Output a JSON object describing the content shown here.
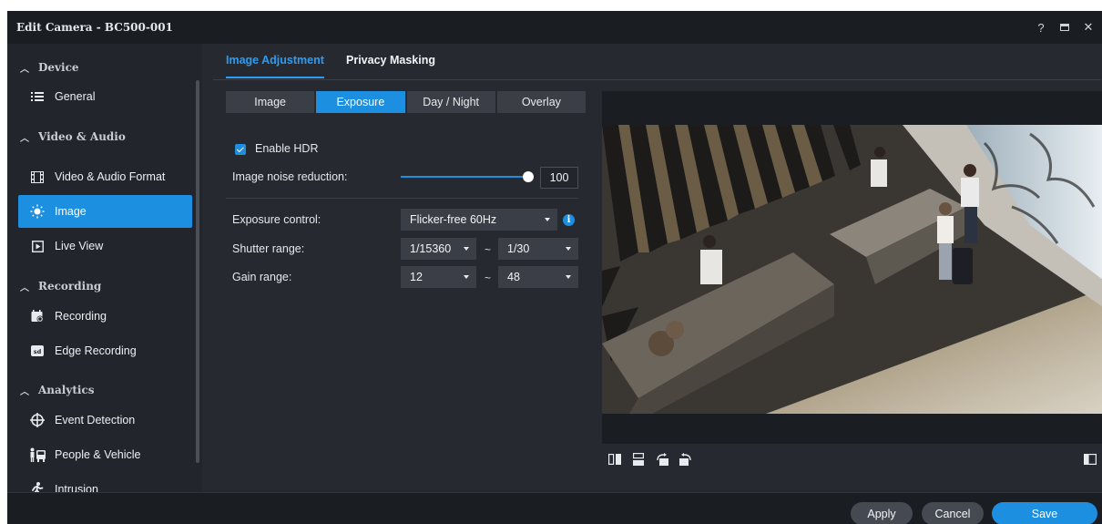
{
  "window": {
    "title": "Edit Camera - BC500-001"
  },
  "sidebar": {
    "sections": [
      {
        "label": "Device"
      },
      {
        "label": "Video & Audio"
      },
      {
        "label": "Recording"
      },
      {
        "label": "Analytics"
      }
    ],
    "items": [
      {
        "label": "General",
        "icon": "list-icon"
      },
      {
        "label": "Video & Audio Format",
        "icon": "film-icon"
      },
      {
        "label": "Image",
        "icon": "brightness-icon",
        "active": true
      },
      {
        "label": "Live View",
        "icon": "play-icon"
      },
      {
        "label": "Recording",
        "icon": "calendar-icon"
      },
      {
        "label": "Edge Recording",
        "icon": "sd-card-icon"
      },
      {
        "label": "Event Detection",
        "icon": "crosshair-icon"
      },
      {
        "label": "People & Vehicle",
        "icon": "person-vehicle-icon"
      },
      {
        "label": "Intrusion",
        "icon": "running-person-icon"
      }
    ]
  },
  "tabs": [
    {
      "label": "Image Adjustment",
      "active": true
    },
    {
      "label": "Privacy Masking",
      "active": false
    }
  ],
  "subtabs": [
    {
      "label": "Image",
      "active": false
    },
    {
      "label": "Exposure",
      "active": true
    },
    {
      "label": "Day / Night",
      "active": false
    },
    {
      "label": "Overlay",
      "active": false
    }
  ],
  "settings": {
    "enable_hdr": {
      "label": "Enable HDR",
      "checked": true
    },
    "noise_reduction": {
      "label": "Image noise reduction:",
      "value": "100",
      "level_percent": 100
    },
    "exposure_control": {
      "label": "Exposure control:",
      "value": "Flicker-free 60Hz"
    },
    "shutter_range": {
      "label": "Shutter range:",
      "min": "1/15360",
      "separator": "~",
      "max": "1/30"
    },
    "gain_range": {
      "label": "Gain range:",
      "min": "12",
      "separator": "~",
      "max": "48"
    }
  },
  "preview": {
    "tools": [
      "flip-horizontal-icon",
      "flip-vertical-icon",
      "rotate-left-icon",
      "rotate-right-icon"
    ],
    "right_tool": "panel-toggle-icon"
  },
  "footer": {
    "apply": "Apply",
    "cancel": "Cancel",
    "save": "Save"
  },
  "colors": {
    "accent": "#1c8fe0",
    "background": "#22262c",
    "titlebar": "#1a1d22"
  }
}
